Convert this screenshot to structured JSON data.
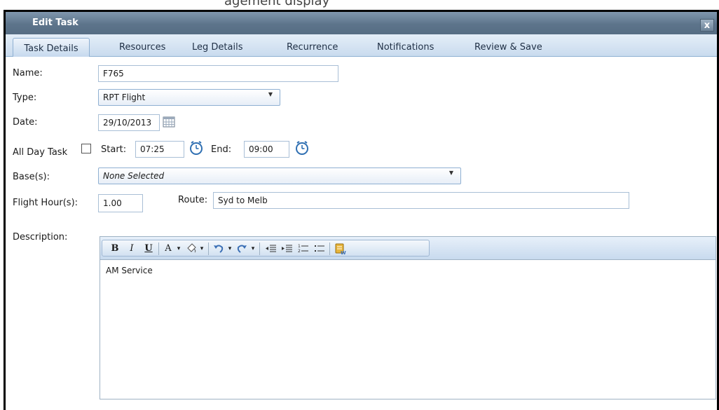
{
  "caption": "agement  display",
  "dialog": {
    "title": "Edit Task",
    "close_label": "x"
  },
  "tabs": [
    {
      "label": "Task Details"
    },
    {
      "label": "Resources"
    },
    {
      "label": "Leg Details"
    },
    {
      "label": "Recurrence"
    },
    {
      "label": "Notifications"
    },
    {
      "label": "Review & Save"
    }
  ],
  "form": {
    "name_label": "Name:",
    "name_value": "F765",
    "type_label": "Type:",
    "type_value": "RPT Flight",
    "date_label": "Date:",
    "date_value": "29/10/2013",
    "allday_label": "All Day Task",
    "start_label": "Start:",
    "start_value": "07:25",
    "end_label": "End:",
    "end_value": "09:00",
    "bases_label": "Base(s):",
    "bases_value": "None Selected",
    "flight_hours_label": "Flight Hour(s):",
    "flight_hours_value": "1.00",
    "route_label": "Route:",
    "route_value": "Syd to Melb",
    "description_label": "Description:",
    "description_value": "AM Service"
  },
  "toolbar": {
    "bold": "B",
    "italic": "I",
    "underline": "U",
    "font_color": "A",
    "dropdown": "▾"
  },
  "colors": {
    "titlebar": "#5d748b",
    "tabbar": "#c9dbee",
    "border_blue": "#8fb0d2"
  },
  "icons": [
    "calendar-icon",
    "clock-icon",
    "bold-icon",
    "italic-icon",
    "underline-icon",
    "font-color-icon",
    "highlight-icon",
    "undo-icon",
    "redo-icon",
    "outdent-icon",
    "indent-icon",
    "numbered-list-icon",
    "bullet-list-icon",
    "spellcheck-icon"
  ]
}
